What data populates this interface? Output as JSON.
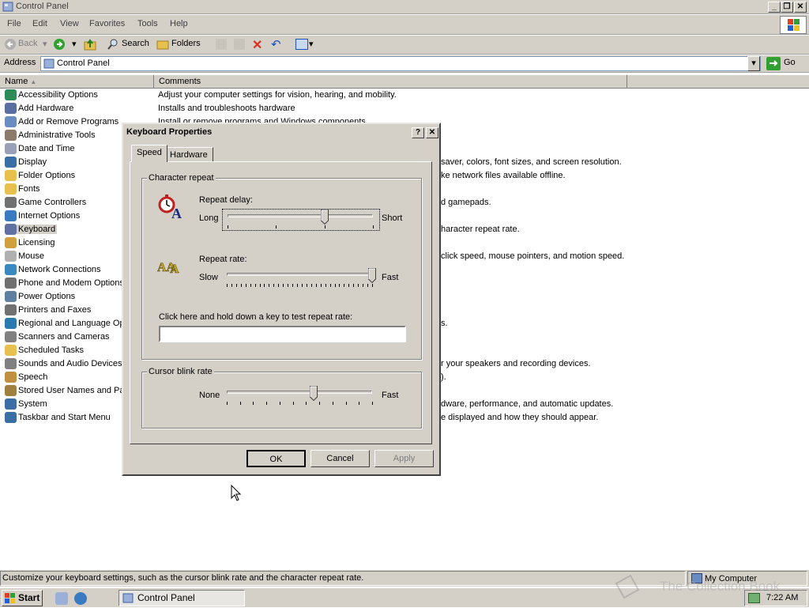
{
  "window": {
    "title": "Control Panel",
    "minimize": "_",
    "restore": "❐",
    "close": "✕"
  },
  "menu": [
    "File",
    "Edit",
    "View",
    "Favorites",
    "Tools",
    "Help"
  ],
  "toolbar": {
    "back": "Back",
    "search": "Search",
    "folders": "Folders"
  },
  "address": {
    "label": "Address",
    "value": "Control Panel",
    "go": "Go"
  },
  "columns": {
    "name": "Name",
    "comments": "Comments"
  },
  "items": [
    {
      "label": "Accessibility Options",
      "icon": "accessibility-icon",
      "color": "#2e8b57"
    },
    {
      "label": "Add Hardware",
      "icon": "add-hardware-icon",
      "color": "#5a6fa0"
    },
    {
      "label": "Add or Remove Programs",
      "icon": "add-remove-programs-icon",
      "color": "#6b8cc0"
    },
    {
      "label": "Administrative Tools",
      "icon": "admin-tools-icon",
      "color": "#8c7a6b"
    },
    {
      "label": "Date and Time",
      "icon": "clock-icon",
      "color": "#9aa0b8"
    },
    {
      "label": "Display",
      "icon": "display-icon",
      "color": "#3a6ea5"
    },
    {
      "label": "Folder Options",
      "icon": "folder-options-icon",
      "color": "#e8c050"
    },
    {
      "label": "Fonts",
      "icon": "fonts-folder-icon",
      "color": "#e8c050"
    },
    {
      "label": "Game Controllers",
      "icon": "game-controller-icon",
      "color": "#707070"
    },
    {
      "label": "Internet Options",
      "icon": "globe-icon",
      "color": "#3a7ac0"
    },
    {
      "label": "Keyboard",
      "icon": "keyboard-icon",
      "color": "#6070a0"
    },
    {
      "label": "Licensing",
      "icon": "licensing-icon",
      "color": "#d0a040"
    },
    {
      "label": "Mouse",
      "icon": "mouse-icon",
      "color": "#b0b0b0"
    },
    {
      "label": "Network Connections",
      "icon": "network-icon",
      "color": "#3a8ac0"
    },
    {
      "label": "Phone and Modem Options",
      "icon": "phone-icon",
      "color": "#707070"
    },
    {
      "label": "Power Options",
      "icon": "power-icon",
      "color": "#6080a0"
    },
    {
      "label": "Printers and Faxes",
      "icon": "printer-icon",
      "color": "#707070"
    },
    {
      "label": "Regional and Language Options",
      "icon": "regional-globe-icon",
      "color": "#2a7ab0"
    },
    {
      "label": "Scanners and Cameras",
      "icon": "scanner-icon",
      "color": "#808080"
    },
    {
      "label": "Scheduled Tasks",
      "icon": "scheduled-tasks-icon",
      "color": "#e8c050"
    },
    {
      "label": "Sounds and Audio Devices",
      "icon": "speaker-icon",
      "color": "#808080"
    },
    {
      "label": "Speech",
      "icon": "speech-icon",
      "color": "#c09040"
    },
    {
      "label": "Stored User Names and Passwords",
      "icon": "key-icon",
      "color": "#a08040"
    },
    {
      "label": "System",
      "icon": "system-icon",
      "color": "#3a6ea5"
    },
    {
      "label": "Taskbar and Start Menu",
      "icon": "taskbar-icon",
      "color": "#3a6ea5"
    }
  ],
  "comments": [
    {
      "row": 0,
      "text": "Adjust your computer settings for vision, hearing, and mobility.",
      "offset": 6
    },
    {
      "row": 1,
      "text": "Installs and troubleshoots hardware",
      "offset": 6
    },
    {
      "row": 2,
      "text": "Install or remove programs and Windows components.",
      "offset": 6
    },
    {
      "row": 5,
      "text": "saver, colors, font sizes, and screen resolution.",
      "offset": 364
    },
    {
      "row": 6,
      "text": "ke network files available offline.",
      "offset": 364
    },
    {
      "row": 8,
      "text": "d gamepads.",
      "offset": 364
    },
    {
      "row": 10,
      "text": "haracter repeat rate.",
      "offset": 364
    },
    {
      "row": 12,
      "text": "click speed, mouse pointers, and motion speed.",
      "offset": 364
    },
    {
      "row": 17,
      "text": "s.",
      "offset": 364
    },
    {
      "row": 20,
      "text": "r your speakers and recording devices.",
      "offset": 364
    },
    {
      "row": 21,
      "text": ").",
      "offset": 364
    },
    {
      "row": 23,
      "text": "dware, performance, and automatic updates.",
      "offset": 364
    },
    {
      "row": 24,
      "text": "e displayed and how they should appear.",
      "offset": 364
    }
  ],
  "dialog": {
    "title": "Keyboard Properties",
    "help": "?",
    "close": "✕",
    "tabs": [
      "Speed",
      "Hardware"
    ],
    "character_repeat": {
      "group_label": "Character repeat",
      "delay_label": "Repeat delay:",
      "delay_left": "Long",
      "delay_right": "Short",
      "delay_value": 0.67,
      "rate_label": "Repeat rate:",
      "rate_left": "Slow",
      "rate_right": "Fast",
      "rate_value": 1.0,
      "test_label": "Click here and hold down a key to test repeat rate:",
      "test_value": ""
    },
    "cursor_blink": {
      "group_label": "Cursor blink rate",
      "left": "None",
      "right": "Fast",
      "value": 0.6
    },
    "buttons": {
      "ok": "OK",
      "cancel": "Cancel",
      "apply": "Apply"
    }
  },
  "status": {
    "text": "Customize your keyboard settings, such as the cursor blink rate and the character repeat rate.",
    "zone": "My Computer"
  },
  "taskbar": {
    "start": "Start",
    "task": "Control Panel",
    "time": "7:22 AM"
  },
  "watermark": "The Collection Book"
}
